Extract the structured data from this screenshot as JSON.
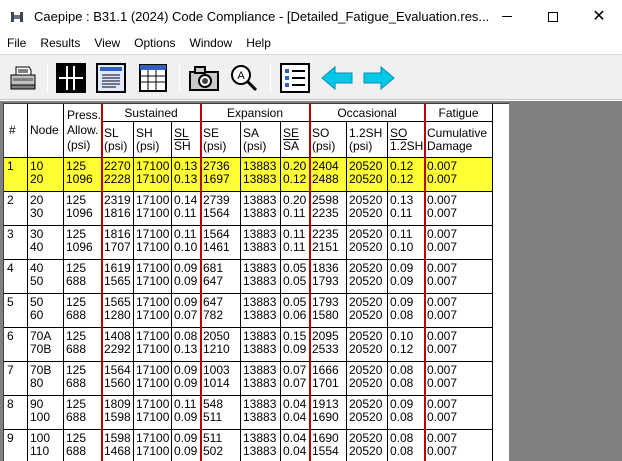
{
  "window": {
    "title": "Caepipe : B31.1 (2024) Code Compliance -  [Detailed_Fatigue_Evaluation.res..."
  },
  "menu": [
    "File",
    "Results",
    "View",
    "Options",
    "Window",
    "Help"
  ],
  "toolbar_icons": [
    "printer-icon",
    "crosshair-grid-icon",
    "text-view-icon",
    "table-view-icon",
    "camera-icon",
    "zoom-icon",
    "list-icon",
    "arrow-left-icon",
    "arrow-right-icon"
  ],
  "colors": {
    "highlight": "#ffff33",
    "separator": "#b80000",
    "arrow": "#00c8e6"
  },
  "table": {
    "row_num_header": "#",
    "node_header": "Node",
    "press_header": [
      "Press.",
      "Allow.",
      "(psi)"
    ],
    "groups": [
      "Sustained",
      "Expansion",
      "Occasional",
      "Fatigue"
    ],
    "sub": {
      "sl": [
        "SL",
        "(psi)"
      ],
      "sh": [
        "SH",
        "(psi)"
      ],
      "slsh": [
        "SL",
        "SH"
      ],
      "se": [
        "SE",
        "(psi)"
      ],
      "sa": [
        "SA",
        "(psi)"
      ],
      "sesa": [
        "SE",
        "SA"
      ],
      "so": [
        "SO",
        "(psi)"
      ],
      "s12": [
        "1.2SH",
        "(psi)"
      ],
      "sosh": [
        "SO",
        "1.2SH"
      ],
      "fat": [
        "Cumulative",
        "Damage"
      ]
    },
    "rows": [
      {
        "num": "1",
        "n": [
          "10",
          "20"
        ],
        "p": [
          "125",
          "1096"
        ],
        "sl": [
          "2270",
          "2228"
        ],
        "sh": [
          "17100",
          "17100"
        ],
        "r1": [
          "0.13",
          "0.13"
        ],
        "se": [
          "2736",
          "1697"
        ],
        "sa": [
          "13883",
          "13883"
        ],
        "r2": [
          "0.20",
          "0.12"
        ],
        "so": [
          "2404",
          "2488"
        ],
        "s12": [
          "20520",
          "20520"
        ],
        "r3": [
          "0.12",
          "0.12"
        ],
        "d": [
          "0.007",
          "0.007"
        ]
      },
      {
        "num": "2",
        "n": [
          "20",
          "30"
        ],
        "p": [
          "125",
          "1096"
        ],
        "sl": [
          "2319",
          "1816"
        ],
        "sh": [
          "17100",
          "17100"
        ],
        "r1": [
          "0.14",
          "0.11"
        ],
        "se": [
          "2739",
          "1564"
        ],
        "sa": [
          "13883",
          "13883"
        ],
        "r2": [
          "0.20",
          "0.11"
        ],
        "so": [
          "2598",
          "2235"
        ],
        "s12": [
          "20520",
          "20520"
        ],
        "r3": [
          "0.13",
          "0.11"
        ],
        "d": [
          "0.007",
          "0.007"
        ]
      },
      {
        "num": "3",
        "n": [
          "30",
          "40"
        ],
        "p": [
          "125",
          "1096"
        ],
        "sl": [
          "1816",
          "1707"
        ],
        "sh": [
          "17100",
          "17100"
        ],
        "r1": [
          "0.11",
          "0.10"
        ],
        "se": [
          "1564",
          "1461"
        ],
        "sa": [
          "13883",
          "13883"
        ],
        "r2": [
          "0.11",
          "0.11"
        ],
        "so": [
          "2235",
          "2151"
        ],
        "s12": [
          "20520",
          "20520"
        ],
        "r3": [
          "0.11",
          "0.10"
        ],
        "d": [
          "0.007",
          "0.007"
        ]
      },
      {
        "num": "4",
        "n": [
          "40",
          "50"
        ],
        "p": [
          "125",
          "688"
        ],
        "sl": [
          "1619",
          "1565"
        ],
        "sh": [
          "17100",
          "17100"
        ],
        "r1": [
          "0.09",
          "0.09"
        ],
        "se": [
          "681",
          "647"
        ],
        "sa": [
          "13883",
          "13883"
        ],
        "r2": [
          "0.05",
          "0.05"
        ],
        "so": [
          "1836",
          "1793"
        ],
        "s12": [
          "20520",
          "20520"
        ],
        "r3": [
          "0.09",
          "0.09"
        ],
        "d": [
          "0.007",
          "0.007"
        ]
      },
      {
        "num": "5",
        "n": [
          "50",
          "60"
        ],
        "p": [
          "125",
          "688"
        ],
        "sl": [
          "1565",
          "1280"
        ],
        "sh": [
          "17100",
          "17100"
        ],
        "r1": [
          "0.09",
          "0.07"
        ],
        "se": [
          "647",
          "782"
        ],
        "sa": [
          "13883",
          "13883"
        ],
        "r2": [
          "0.05",
          "0.06"
        ],
        "so": [
          "1793",
          "1580"
        ],
        "s12": [
          "20520",
          "20520"
        ],
        "r3": [
          "0.09",
          "0.08"
        ],
        "d": [
          "0.007",
          "0.007"
        ]
      },
      {
        "num": "6",
        "n": [
          "70A",
          "70B"
        ],
        "p": [
          "125",
          "688"
        ],
        "sl": [
          "1408",
          "2292"
        ],
        "sh": [
          "17100",
          "17100"
        ],
        "r1": [
          "0.08",
          "0.13"
        ],
        "se": [
          "2050",
          "1210"
        ],
        "sa": [
          "13883",
          "13883"
        ],
        "r2": [
          "0.15",
          "0.09"
        ],
        "so": [
          "2095",
          "2533"
        ],
        "s12": [
          "20520",
          "20520"
        ],
        "r3": [
          "0.10",
          "0.12"
        ],
        "d": [
          "0.007",
          "0.007"
        ]
      },
      {
        "num": "7",
        "n": [
          "70B",
          "80"
        ],
        "p": [
          "125",
          "688"
        ],
        "sl": [
          "1564",
          "1560"
        ],
        "sh": [
          "17100",
          "17100"
        ],
        "r1": [
          "0.09",
          "0.09"
        ],
        "se": [
          "1003",
          "1014"
        ],
        "sa": [
          "13883",
          "13883"
        ],
        "r2": [
          "0.07",
          "0.07"
        ],
        "so": [
          "1666",
          "1701"
        ],
        "s12": [
          "20520",
          "20520"
        ],
        "r3": [
          "0.08",
          "0.08"
        ],
        "d": [
          "0.007",
          "0.007"
        ]
      },
      {
        "num": "8",
        "n": [
          "90",
          "100"
        ],
        "p": [
          "125",
          "688"
        ],
        "sl": [
          "1809",
          "1598"
        ],
        "sh": [
          "17100",
          "17100"
        ],
        "r1": [
          "0.11",
          "0.09"
        ],
        "se": [
          "548",
          "511"
        ],
        "sa": [
          "13883",
          "13883"
        ],
        "r2": [
          "0.04",
          "0.04"
        ],
        "so": [
          "1913",
          "1690"
        ],
        "s12": [
          "20520",
          "20520"
        ],
        "r3": [
          "0.09",
          "0.08"
        ],
        "d": [
          "0.007",
          "0.007"
        ]
      },
      {
        "num": "9",
        "n": [
          "100",
          "110"
        ],
        "p": [
          "125",
          "688"
        ],
        "sl": [
          "1598",
          "1468"
        ],
        "sh": [
          "17100",
          "17100"
        ],
        "r1": [
          "0.09",
          "0.09"
        ],
        "se": [
          "511",
          "502"
        ],
        "sa": [
          "13883",
          "13883"
        ],
        "r2": [
          "0.04",
          "0.04"
        ],
        "so": [
          "1690",
          "1554"
        ],
        "s12": [
          "20520",
          "20520"
        ],
        "r3": [
          "0.08",
          "0.08"
        ],
        "d": [
          "0.007",
          "0.007"
        ]
      }
    ]
  }
}
